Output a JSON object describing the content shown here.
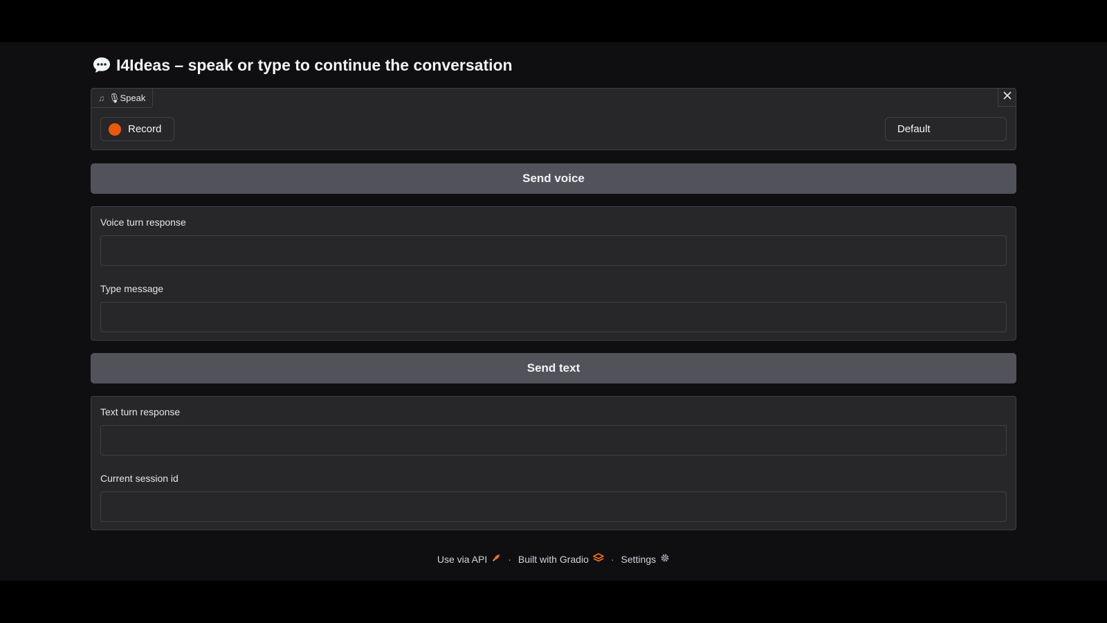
{
  "header": {
    "icon": "speech-bubble-icon",
    "title": "I4Ideas – speak or type to continue the conversation"
  },
  "audio": {
    "tab_icon": "music-note-icon",
    "tab_label": "🎙Speak",
    "record_label": "Record",
    "record_color": "#ea580c",
    "device": "Default"
  },
  "buttons": {
    "send_voice": "Send voice",
    "send_text": "Send text"
  },
  "fields": {
    "voice_response_label": "Voice turn response",
    "voice_response_value": "",
    "type_message_label": "Type message",
    "type_message_value": "",
    "text_response_label": "Text turn response",
    "text_response_value": "",
    "session_id_label": "Current session id",
    "session_id_value": ""
  },
  "footer": {
    "api": "Use via API",
    "gradio": "Built with Gradio",
    "settings": "Settings",
    "separator": "·"
  },
  "colors": {
    "background": "#0f0f11",
    "panel": "#27272a",
    "button": "#52525b",
    "accent": "#ea580c"
  }
}
